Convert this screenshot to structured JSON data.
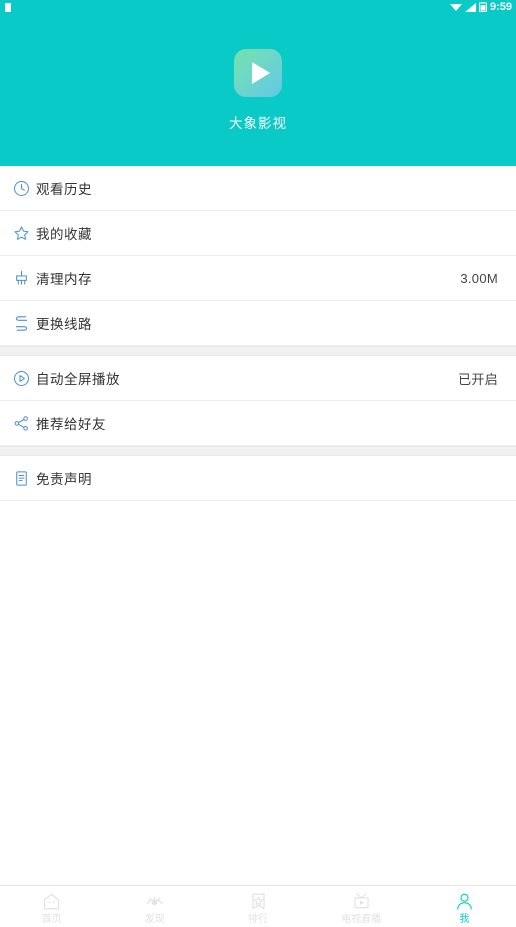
{
  "statusbar": {
    "time": "9:59",
    "icons": [
      "download-icon",
      "signal-icon",
      "battery-icon"
    ]
  },
  "header": {
    "app_icon": "play-app-icon",
    "app_title": "大象影视",
    "background_color": "#0ACAC8",
    "icon_gradient_from": "#72E0AE",
    "icon_gradient_to": "#63C6E8"
  },
  "menu": {
    "groups": [
      {
        "items": [
          {
            "icon": "clock-icon",
            "label": "观看历史",
            "value": ""
          },
          {
            "icon": "star-icon",
            "label": "我的收藏",
            "value": ""
          },
          {
            "icon": "broom-icon",
            "label": "清理内存",
            "value": "3.00M"
          },
          {
            "icon": "swap-icon",
            "label": "更换线路",
            "value": ""
          }
        ]
      },
      {
        "items": [
          {
            "icon": "play-circle-icon",
            "label": "自动全屏播放",
            "value": "已开启"
          },
          {
            "icon": "share-icon",
            "label": "推荐给好友",
            "value": ""
          }
        ]
      },
      {
        "items": [
          {
            "icon": "document-icon",
            "label": "免责声明",
            "value": ""
          }
        ]
      }
    ],
    "icon_color": "#4a90cf"
  },
  "tabbar": {
    "active_color": "#14CFCB",
    "inactive_color": "#e2e2e2",
    "tabs": [
      {
        "icon": "home-icon",
        "label": "首页",
        "active": false
      },
      {
        "icon": "eye-icon",
        "label": "发现",
        "active": false
      },
      {
        "icon": "rank-icon",
        "label": "排行",
        "active": false
      },
      {
        "icon": "tv-icon",
        "label": "电视直播",
        "active": false
      },
      {
        "icon": "person-icon",
        "label": "我",
        "active": true
      }
    ]
  }
}
